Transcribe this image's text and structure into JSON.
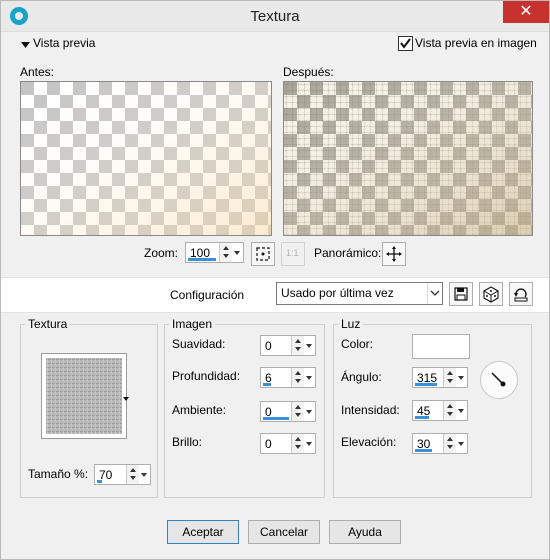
{
  "window": {
    "title": "Textura"
  },
  "preview_section": {
    "label": "Vista previa",
    "checkbox_label": "Vista previa en imagen",
    "checkbox_checked": true
  },
  "before": {
    "label": "Antes:"
  },
  "after": {
    "label": "Después:"
  },
  "zoom": {
    "label": "Zoom:",
    "value": "100",
    "one_to_one": "1:1"
  },
  "panoramic": {
    "label": "Panorámico:"
  },
  "configuration": {
    "label": "Configuración",
    "selected": "Usado por última vez"
  },
  "texture_group": {
    "title": "Textura",
    "size_label": "Tamaño %:",
    "size_value": "70"
  },
  "image_group": {
    "title": "Imagen",
    "fields": [
      {
        "label": "Suavidad:",
        "value": "0"
      },
      {
        "label": "Profundidad:",
        "value": "6"
      },
      {
        "label": "Ambiente:",
        "value": "0"
      },
      {
        "label": "Brillo:",
        "value": "0"
      }
    ]
  },
  "light_group": {
    "title": "Luz",
    "color_label": "Color:",
    "color_value": "#ffffff",
    "angle_label": "Ángulo:",
    "angle_value": "315",
    "intensity_label": "Intensidad:",
    "intensity_value": "45",
    "elevation_label": "Elevación:",
    "elevation_value": "30"
  },
  "buttons": {
    "accept": "Aceptar",
    "cancel": "Cancelar",
    "help": "Ayuda"
  },
  "colors": {
    "accent": "#3a8fd9",
    "close": "#c7322f"
  }
}
